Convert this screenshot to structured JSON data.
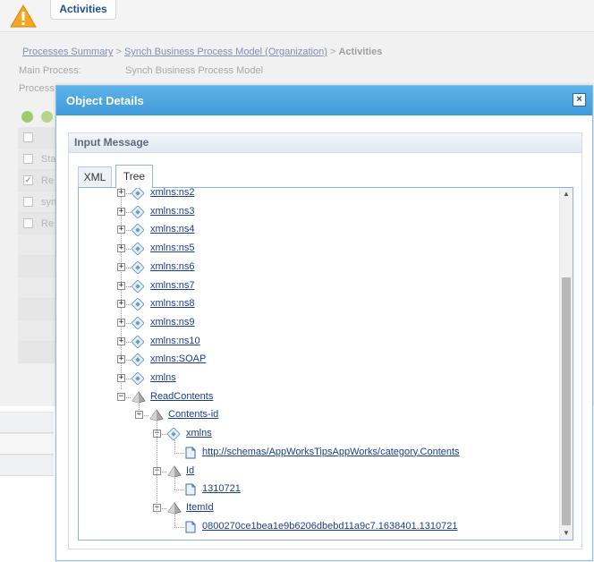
{
  "header": {
    "tab_label": "Activities"
  },
  "breadcrumb": {
    "items": [
      "Processes Summary",
      "Synch Business Process Model (Organization)"
    ],
    "separator": ">",
    "current": "Activities"
  },
  "info": {
    "main_process_label": "Main Process:",
    "main_process_value": "Synch Business Process Model",
    "process_label": "Process"
  },
  "bg_grid_rows": [
    "Sta",
    "Re",
    "syn",
    "Re"
  ],
  "modal": {
    "title": "Object Details",
    "close": "×",
    "panel_title": "Input Message",
    "tabs": [
      "XML",
      "Tree"
    ],
    "active_tab": "Tree"
  },
  "tree": {
    "partial_top": "xmlns:ns2",
    "xmlns_nodes": [
      "xmlns:ns3",
      "xmlns:ns4",
      "xmlns:ns5",
      "xmlns:ns6",
      "xmlns:ns7",
      "xmlns:ns8",
      "xmlns:ns9",
      "xmlns:ns10",
      "xmlns:SOAP",
      "xmlns"
    ],
    "read_contents": "ReadContents",
    "contents_id": "Contents-id",
    "child_xmlns": "xmlns",
    "child_xmlns_value": "http://schemas/AppWorksTipsAppWorks/category.Contents",
    "id_label": "Id",
    "id_value": "1310721",
    "itemid_label": "ItemId",
    "itemid_value": "0800270ce1bea1e9b6206dbebd11a9c7.1638401.1310721"
  },
  "colors": {
    "accent": "#3f9ad8",
    "link": "#1a3e8c",
    "panel_header": "#e2e8f1"
  }
}
